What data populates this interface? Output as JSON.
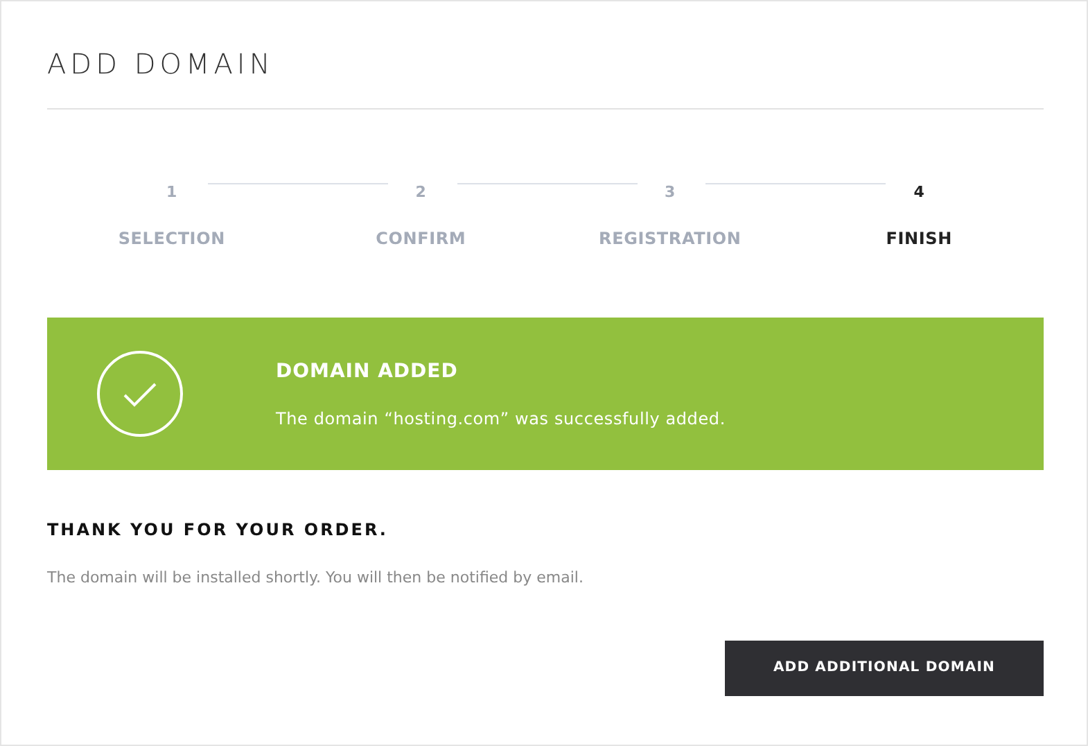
{
  "title": "ADD DOMAIN",
  "steps": [
    {
      "number": "1",
      "label": "SELECTION",
      "selected": false
    },
    {
      "number": "2",
      "label": "CONFIRM",
      "selected": false
    },
    {
      "number": "3",
      "label": "REGISTRATION",
      "selected": false
    },
    {
      "number": "4",
      "label": "FINISH",
      "selected": true
    }
  ],
  "alert": {
    "title": "DOMAIN ADDED",
    "message": "The domain “hosting.com” was successfully added."
  },
  "thanks": {
    "heading": "THANK YOU FOR YOUR ORDER.",
    "text": "The domain will be installed shortly. You will then be notified by email."
  },
  "button": "ADD ADDITIONAL DOMAIN"
}
